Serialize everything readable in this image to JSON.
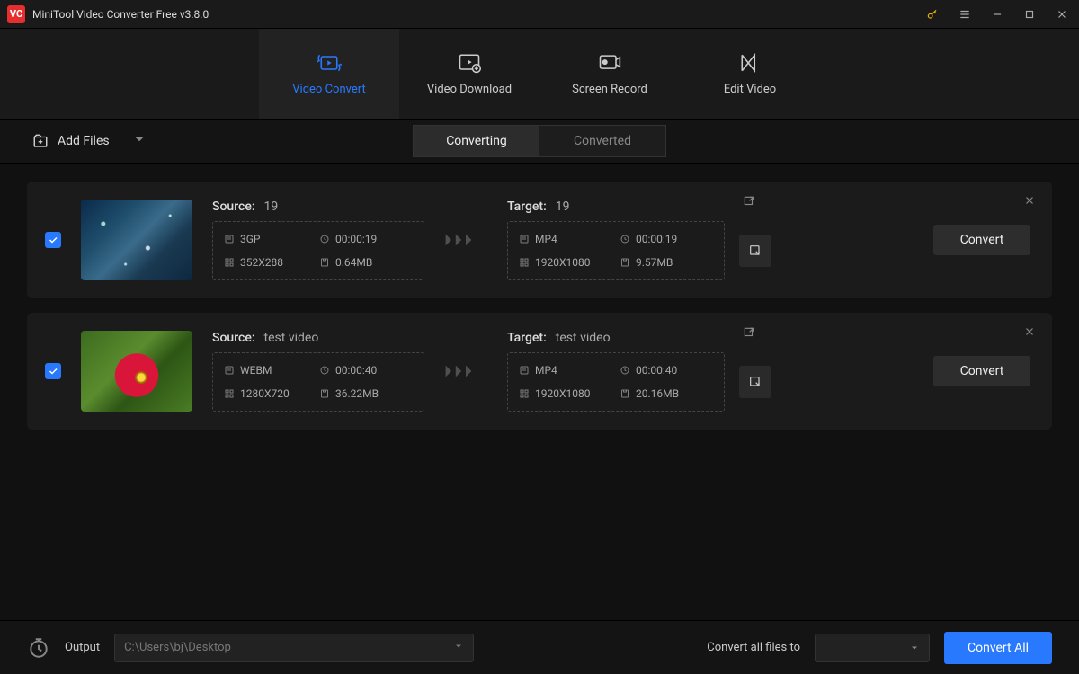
{
  "app": {
    "title": "MiniTool Video Converter Free v3.8.0"
  },
  "nav": {
    "video_convert": "Video Convert",
    "video_download": "Video Download",
    "screen_record": "Screen Record",
    "edit_video": "Edit Video"
  },
  "toolbar": {
    "add_files": "Add Files",
    "tab_converting": "Converting",
    "tab_converted": "Converted"
  },
  "labels": {
    "source": "Source:",
    "target": "Target:",
    "convert": "Convert"
  },
  "items": [
    {
      "name": "19",
      "source": {
        "format": "3GP",
        "duration": "00:00:19",
        "resolution": "352X288",
        "size": "0.64MB"
      },
      "target": {
        "format": "MP4",
        "duration": "00:00:19",
        "resolution": "1920X1080",
        "size": "9.57MB"
      }
    },
    {
      "name": "test video",
      "source": {
        "format": "WEBM",
        "duration": "00:00:40",
        "resolution": "1280X720",
        "size": "36.22MB"
      },
      "target": {
        "format": "MP4",
        "duration": "00:00:40",
        "resolution": "1920X1080",
        "size": "20.16MB"
      }
    }
  ],
  "footer": {
    "output_label": "Output",
    "output_path": "C:\\Users\\bj\\Desktop",
    "convert_all_to": "Convert all files to",
    "convert_all": "Convert All"
  }
}
